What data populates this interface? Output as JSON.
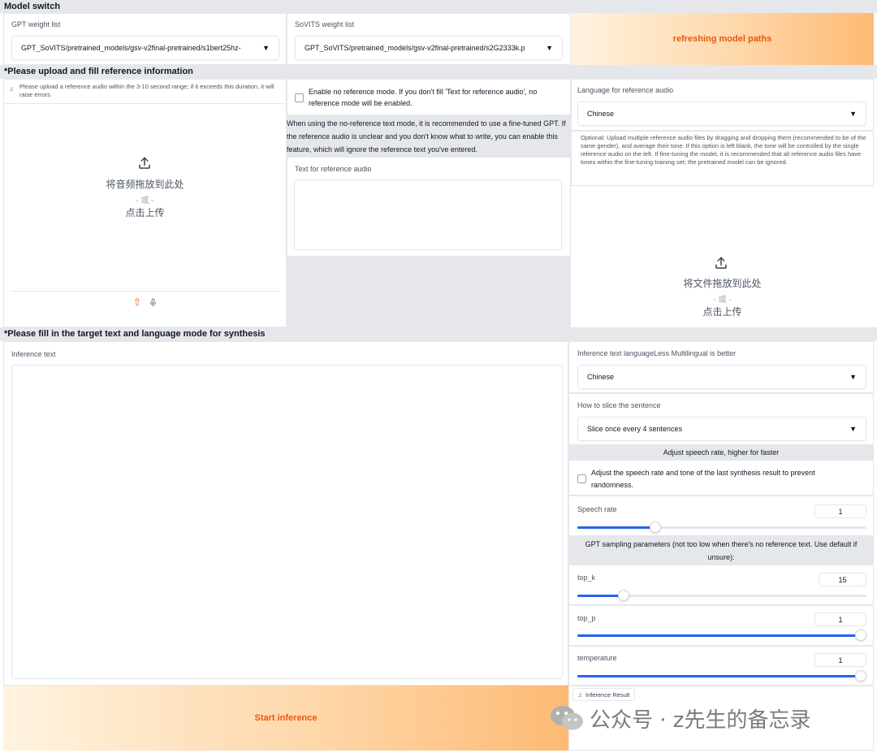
{
  "model_switch": {
    "title": "Model switch",
    "gpt_label": "GPT weight list",
    "gpt_value": "GPT_SoVITS/pretrained_models/gsv-v2final-pretrained/s1bert25hz-",
    "sovits_label": "SoVITS weight list",
    "sovits_value": "GPT_SoVITS/pretrained_models/gsv-v2final-pretrained/s2G2333k.p",
    "refresh_label": "refreshing model paths"
  },
  "reference": {
    "title": "*Please upload and fill reference information",
    "audio_hint": "Please upload a reference audio within the 3-10 second range; if it exceeds this duration, it will raise errors.",
    "upload_drop": "将音频拖放到此处",
    "upload_or": "- 或 -",
    "upload_click": "点击上传",
    "no_ref_label": "Enable no reference mode. If you don't fill 'Text for reference audio', no reference mode will be enabled.",
    "no_ref_info": "When using the no-reference text mode, it is recommended to use a fine-tuned GPT. If the reference audio is unclear and you don't know what to write, you can enable this feature, which will ignore the reference text you've entered.",
    "text_label": "Text for reference audio",
    "text_value": "",
    "lang_label": "Language for reference audio",
    "lang_value": "Chinese",
    "multi_hint": "Optional: Upload multiple reference audio files by dragging and dropping them (recommended to be of the same gender), and average their tone. If this option is left blank, the tone will be controlled by the single reference audio on the left. If fine-tuning the model, it is recommended that all reference audio files have tones within the fine-tuning training set; the pretrained model can be ignored.",
    "file_drop": "将文件拖放到此处",
    "file_or": "- 或 -",
    "file_click": "点击上传"
  },
  "synthesis": {
    "title": "*Please fill in the target text and language mode for synthesis",
    "inference_label": "Inference text",
    "inference_value": "",
    "lang_label": "Inference text languageLess Multilingual is better",
    "lang_value": "Chinese",
    "slice_label": "How to slice the sentence",
    "slice_value": "Slice once every 4 sentences",
    "speed_header": "Adjust speech rate, higher for faster",
    "fix_label": "Adjust the speech rate and tone of the last synthesis result to prevent randomness.",
    "speed_label": "Speech rate",
    "speed_value": "1",
    "speed_fraction": 0.27,
    "gpt_header": "GPT sampling parameters (not too low when there's no reference text. Use default if unsure):",
    "topk_label": "top_k",
    "topk_value": "15",
    "topk_fraction": 0.16,
    "topp_label": "top_p",
    "topp_value": "1",
    "topp_fraction": 1.0,
    "temp_label": "temperature",
    "temp_value": "1",
    "temp_fraction": 1.0,
    "start_label": "Start inference",
    "result_label": "Inference Result"
  },
  "watermark": "公众号 · z先生的备忘录",
  "colors": {
    "accent": "#ea580c",
    "slider": "#2563eb",
    "section_bg": "#e5e7eb"
  }
}
